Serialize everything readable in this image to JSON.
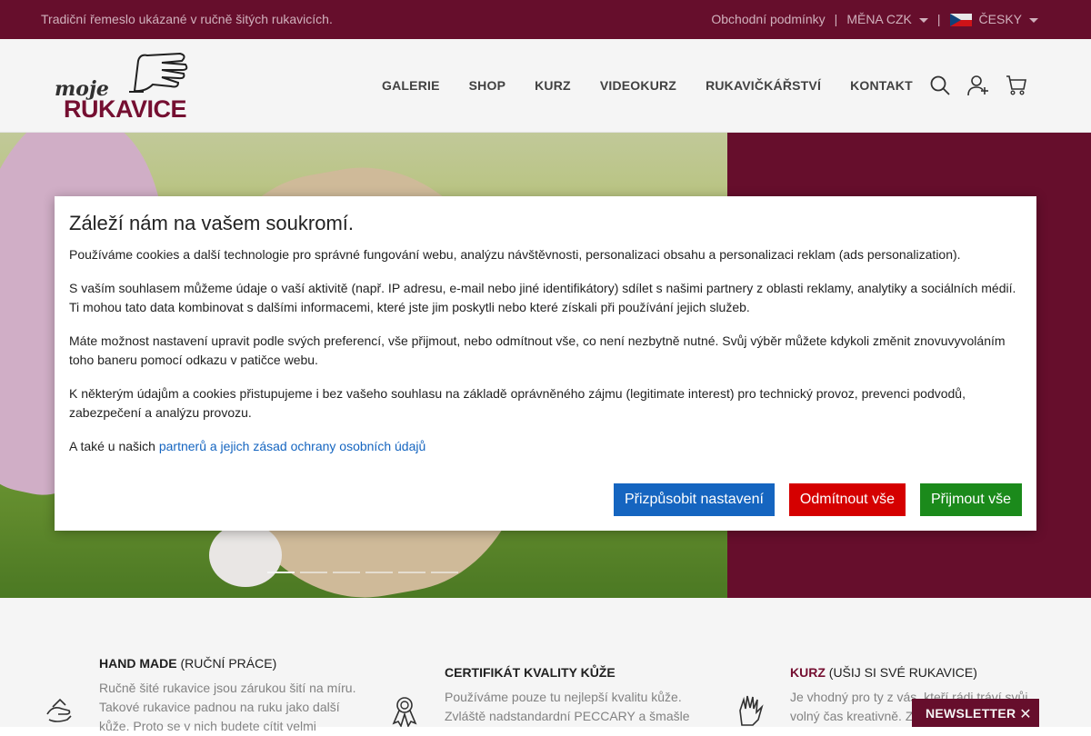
{
  "topbar": {
    "tagline": "Tradiční řemeslo ukázané v ručně šitých rukavicích.",
    "terms": "Obchodní podmínky",
    "separator": "|",
    "currency": "MĚNA CZK",
    "language": "ČESKY"
  },
  "logo": {
    "top": "moje",
    "bottom": "RUKAVICE"
  },
  "nav": [
    "GALERIE",
    "SHOP",
    "KURZ",
    "VIDEOKURZ",
    "RUKAVIČKÁŘSTVÍ",
    "KONTAKT"
  ],
  "header_icons": [
    "search-icon",
    "add-user-icon",
    "cart-icon"
  ],
  "slider": {
    "dot_count": 6,
    "active_index": 0
  },
  "features": [
    {
      "title": "HAND MADE",
      "subtitle": "(RUČNÍ PRÁCE)",
      "text": "Ručně šité rukavice jsou zárukou šití na míru. Takové rukavice padnou na ruku jako další kůže. Proto se v nich budete cítit velmi",
      "icon": "handmade-icon"
    },
    {
      "title": "CERTIFIKÁT KVALITY KŮŽE",
      "subtitle": "",
      "text": "Používáme pouze tu nejlepší kvalitu kůže. Zvláště nadstandardní PECCARY a šmašle",
      "icon": "certificate-icon"
    },
    {
      "title": "KURZ",
      "subtitle": "(UŠIJ SI SVÉ RUKAVICE)",
      "text": "Je vhodný pro ty z vás, kteří rádi tráví svůj volný čas kreativně. Z",
      "icon": "glove-icon"
    }
  ],
  "newsletter": {
    "label": "NEWSLETTER",
    "close": "✕"
  },
  "cookie": {
    "title": "Záleží nám na vašem soukromí.",
    "p1": "Používáme cookies a další technologie pro správné fungování webu, analýzu návštěvnosti, personalizaci obsahu a personalizaci reklam (ads personalization).",
    "p2": "S vaším souhlasem můžeme údaje o vaší aktivitě (např. IP adresu, e-mail nebo jiné identifikátory) sdílet s našimi partnery z oblasti reklamy, analytiky a sociálních médií. Ti mohou tato data kombinovat s dalšími informacemi, které jste jim poskytli nebo které získali při používání jejich služeb.",
    "p3": "Máte možnost nastavení upravit podle svých preferencí, vše přijmout, nebo odmítnout vše, co není nezbytně nutné. Svůj výběr můžete kdykoli změnit znovuvyvoláním toho baneru pomocí odkazu v patičce webu.",
    "p4": "K některým údajům a cookies přistupujeme i bez vašeho souhlasu na základě oprávněného zájmu (legitimate interest) pro technický provoz, prevenci podvodů, zabezpečení a analýzu provozu.",
    "p5_prefix": "A také u našich",
    "p5_link": "partnerů a jejich zásad ochrany osobních údajů",
    "btn_customize": "Přizpůsobit nastavení",
    "btn_reject": "Odmítnout vše",
    "btn_accept": "Přijmout vše"
  },
  "colors": {
    "brand": "#6b0f2e",
    "link": "#1565c0",
    "reject": "#d50000",
    "accept": "#1b8a1b"
  }
}
